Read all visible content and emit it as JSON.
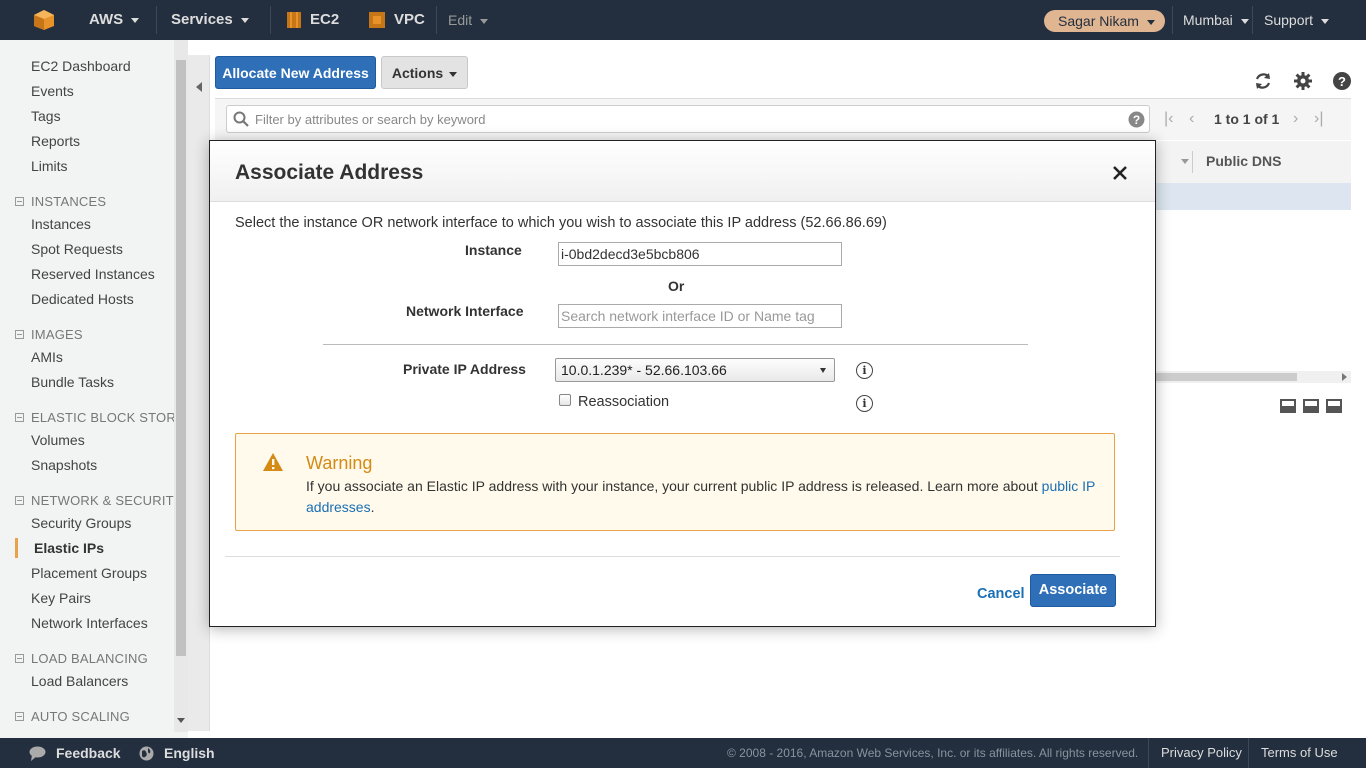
{
  "topbar": {
    "brand": "AWS",
    "services": "Services",
    "ec2": "EC2",
    "vpc": "VPC",
    "edit": "Edit",
    "user": "Sagar Nikam",
    "region": "Mumbai",
    "support": "Support"
  },
  "sidebar": {
    "top_items": [
      "EC2 Dashboard",
      "Events",
      "Tags",
      "Reports",
      "Limits"
    ],
    "sections": [
      {
        "title": "INSTANCES",
        "items": [
          "Instances",
          "Spot Requests",
          "Reserved Instances",
          "Dedicated Hosts"
        ]
      },
      {
        "title": "IMAGES",
        "items": [
          "AMIs",
          "Bundle Tasks"
        ]
      },
      {
        "title": "ELASTIC BLOCK STORE",
        "items": [
          "Volumes",
          "Snapshots"
        ]
      },
      {
        "title": "NETWORK & SECURITY",
        "items": [
          "Security Groups",
          "Elastic IPs",
          "Placement Groups",
          "Key Pairs",
          "Network Interfaces"
        ]
      },
      {
        "title": "LOAD BALANCING",
        "items": [
          "Load Balancers"
        ]
      },
      {
        "title": "AUTO SCALING",
        "items": []
      }
    ],
    "active_item": "Elastic IPs"
  },
  "toolbar": {
    "allocate_label": "Allocate New Address",
    "actions_label": "Actions",
    "filter_placeholder": "Filter by attributes or search by keyword",
    "pager_text": "1 to 1 of 1",
    "column_header": "Public DNS"
  },
  "modal": {
    "title": "Associate Address",
    "description": "Select the instance OR network interface to which you wish to associate this IP address (52.66.86.69)",
    "instance_label": "Instance",
    "instance_value": "i-0bd2decd3e5bcb806",
    "or_label": "Or",
    "network_interface_label": "Network Interface",
    "network_interface_placeholder": "Search network interface ID or Name tag",
    "private_ip_label": "Private IP Address",
    "private_ip_value": "10.0.1.239* - 52.66.103.66",
    "reassociation_label": "Reassociation",
    "reassociation_checked": false,
    "warning_title": "Warning",
    "warning_text": "If you associate an Elastic IP address with your instance, your current public IP address is released. Learn more about ",
    "warning_link": "public IP addresses",
    "warning_end": ".",
    "cancel_label": "Cancel",
    "associate_label": "Associate"
  },
  "footer": {
    "feedback": "Feedback",
    "language": "English",
    "copyright": "© 2008 - 2016, Amazon Web Services, Inc. or its affiliates. All rights reserved.",
    "privacy": "Privacy Policy",
    "terms": "Terms of Use"
  },
  "colors": {
    "navbar": "#232f3e",
    "primary": "#2e6fb7",
    "warning_border": "#e7a24a",
    "warning_bg": "#fffaeb",
    "link": "#1a6fb5"
  }
}
